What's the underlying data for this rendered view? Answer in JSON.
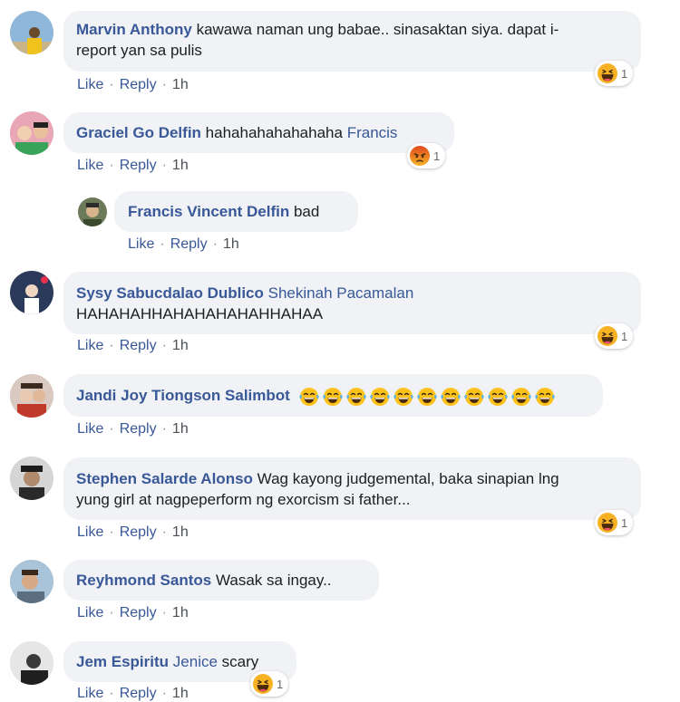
{
  "actions": {
    "like": "Like",
    "reply": "Reply",
    "sep": "·"
  },
  "colors": {
    "author": "#385898",
    "bubble": "#f0f2f5",
    "haha": "#f7b125",
    "angry": "#e9710f"
  },
  "comments": [
    {
      "author": "Marvin Anthony",
      "line1": "kawawa naman ung babae.. sinasaktan siya. dapat i-",
      "line2": "report yan sa pulis",
      "time": "1h",
      "reaction": {
        "icon": "haha-icon",
        "count": "1"
      }
    },
    {
      "author": "Graciel Go Delfin",
      "text": "hahahahahahahaha",
      "mention": "Francis",
      "time": "1h",
      "reaction": {
        "icon": "angry-icon",
        "count": "1"
      }
    },
    {
      "author": "Francis Vincent Delfin",
      "text": "bad",
      "time": "1h"
    },
    {
      "author": "Sysy Sabucdalao Dublico",
      "mention": "Shekinah Pacamalan",
      "line2": "HAHAHAHHAHAHAHAHAHHAHAA",
      "time": "1h",
      "reaction": {
        "icon": "haha-icon",
        "count": "1"
      }
    },
    {
      "author": "Jandi Joy Tiongson Salimbot",
      "emoji": "laughing-tears-icon",
      "emoji_count": 11,
      "time": "1h"
    },
    {
      "author": "Stephen Salarde Alonso",
      "line1": "Wag kayong judgemental, baka sinapian lng",
      "line2": "yung girl at nagpeperform ng exorcism si father...",
      "time": "1h",
      "reaction": {
        "icon": "haha-icon",
        "count": "1"
      }
    },
    {
      "author": "Reyhmond Santos",
      "text": "Wasak sa ingay..",
      "time": "1h"
    },
    {
      "author": "Jem Espiritu",
      "mention": "Jenice",
      "text": "scary",
      "time": "1h",
      "reaction": {
        "icon": "haha-icon",
        "count": "1"
      }
    }
  ]
}
